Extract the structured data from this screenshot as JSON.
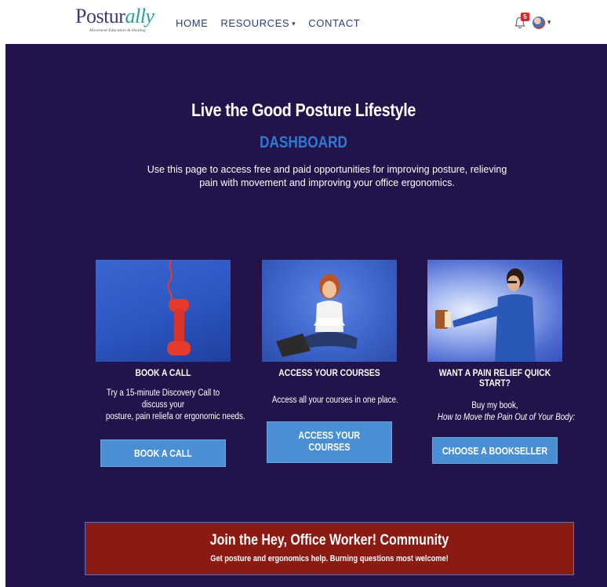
{
  "header": {
    "logo_word": "Postur",
    "logo_tail": "ally",
    "logo_tagline": "Movement Education & Healing",
    "nav": [
      {
        "label": "HOME"
      },
      {
        "label": "RESOURCES"
      },
      {
        "label": "CONTACT"
      }
    ],
    "notification_count": "5"
  },
  "hero": {
    "title": "Live the Good Posture Lifestyle",
    "subtitle": "DASHBOARD",
    "intro": "Use this page to access free and paid opportunities for improving posture, relieving pain with movement and improving your office ergonomics."
  },
  "cards": [
    {
      "title": "BOOK A CALL",
      "text_lines": [
        "Try a 15-minute Discovery Call to",
        "discuss your",
        "posture, pain reliefa or ergonomic needs."
      ],
      "button": "BOOK A CALL"
    },
    {
      "title": "ACCESS YOUR COURSES",
      "text_lines": [
        "Access all your courses in one place."
      ],
      "button_lines": [
        "ACCESS YOUR",
        "COURSES"
      ]
    },
    {
      "title_lines": [
        "WANT A PAIN RELIEF QUICK",
        "START?"
      ],
      "text_lines": [
        "Buy my book,",
        "How to Move the Pain Out of Your Body:"
      ],
      "button": "CHOOSE A BOOKSELLER"
    }
  ],
  "community": {
    "title": "Join the Hey, Office Worker! Community",
    "subtitle": "Get posture and ergonomics help. Burning questions most welcome!"
  },
  "colors": {
    "hero_background": "#22134a",
    "subtitle_blue": "#2f79d6",
    "button_blue": "#4a8fd4",
    "banner_red": "#8b1a13",
    "logo_navy": "#3c3a78",
    "logo_teal": "#2b9e9a"
  }
}
